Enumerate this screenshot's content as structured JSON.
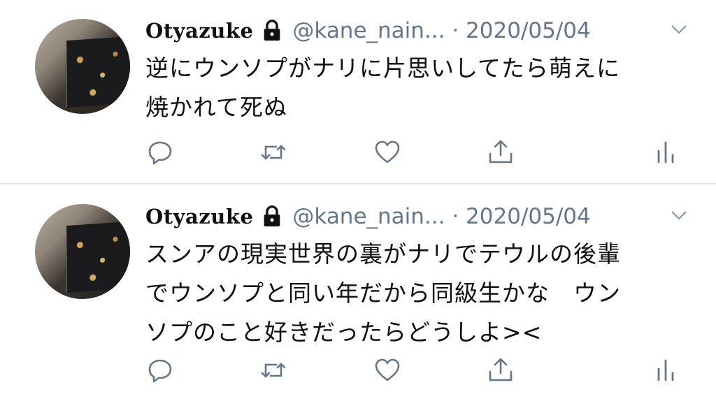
{
  "tweets": [
    {
      "display_name": "Otyazuke",
      "handle_date": "@kane_nain... · 2020/05/04",
      "text_lines": [
        "逆にウンソプがナリに片思いしてたら萌えに",
        "焼かれて死ぬ"
      ]
    },
    {
      "display_name": "Otyazuke",
      "handle_date": "@kane_nain... · 2020/05/04",
      "text_lines": [
        "スンアの現実世界の裏がナリでテウルの後輩",
        "でウンソプと同い年だから同級生かな　ウン",
        "ソプのこと好きだったらどうしよ><"
      ]
    }
  ],
  "icons": {
    "protected": "lock-icon",
    "menu": "chevron-down-icon",
    "reply": "reply-icon",
    "retweet": "retweet-icon",
    "like": "heart-icon",
    "share": "share-icon",
    "analytics": "analytics-icon"
  },
  "colors": {
    "text": "#111111",
    "secondary": "#657786",
    "icon": "#657786",
    "divider": "#e3e5e8"
  }
}
